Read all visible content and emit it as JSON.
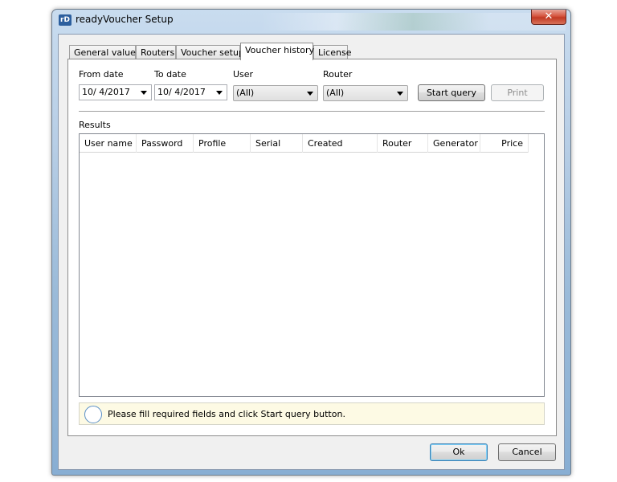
{
  "window": {
    "title": "readyVoucher Setup",
    "icon_text": "rD",
    "close_label": "✕"
  },
  "tabs": [
    {
      "label": "General values"
    },
    {
      "label": "Routers"
    },
    {
      "label": "Voucher setup"
    },
    {
      "label": "Voucher history",
      "active": true
    },
    {
      "label": "License"
    }
  ],
  "filters": {
    "from_date_label": "From date",
    "from_date_value": "10/  4/2017",
    "to_date_label": "To date",
    "to_date_value": "10/  4/2017",
    "user_label": "User",
    "user_value": "(All)",
    "router_label": "Router",
    "router_value": "(All)",
    "start_query_label": "Start query",
    "print_label": "Print"
  },
  "results": {
    "label": "Results",
    "columns": [
      "User name",
      "Password",
      "Profile",
      "Serial",
      "Created",
      "Router",
      "Generator",
      "Price"
    ],
    "rows": []
  },
  "status": {
    "message": "Please fill required fields and click Start query button."
  },
  "footer": {
    "ok_label": "Ok",
    "cancel_label": "Cancel"
  }
}
